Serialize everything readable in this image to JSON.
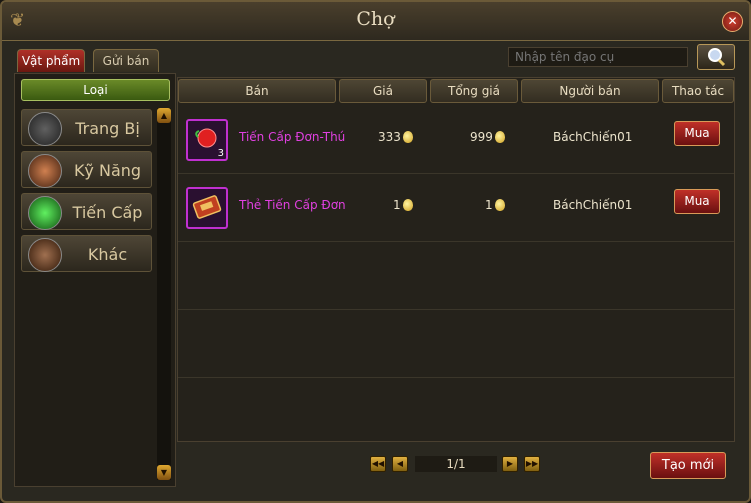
{
  "window": {
    "title": "Chợ",
    "close_label": "✕"
  },
  "tabs": [
    {
      "label": "Vật phẩm",
      "active": true
    },
    {
      "label": "Gửi bán",
      "active": false
    }
  ],
  "search": {
    "placeholder": "Nhập tên đạo cụ"
  },
  "categories": {
    "header": "Loại",
    "items": [
      {
        "label": "Trang Bị",
        "icon": "sword-icon"
      },
      {
        "label": "Kỹ Năng",
        "icon": "skill-book-icon"
      },
      {
        "label": "Tiến Cấp",
        "icon": "green-gem-icon"
      },
      {
        "label": "Khác",
        "icon": "chest-icon"
      }
    ]
  },
  "table": {
    "columns": [
      "Bán",
      "Giá",
      "Tổng giá",
      "Người bán",
      "Thao tác"
    ],
    "rows": [
      {
        "name": "Tiến Cấp Đơn-Thú",
        "qty": "3",
        "price": "333",
        "total": "999",
        "seller": "BáchChiến01",
        "action": "Mua",
        "icon": "red-pill-icon"
      },
      {
        "name": "Thẻ Tiến Cấp Đơn",
        "qty": "",
        "price": "1",
        "total": "1",
        "seller": "BáchChiến01",
        "action": "Mua",
        "icon": "card-icon"
      }
    ]
  },
  "pagination": {
    "text": "1/1"
  },
  "create_button": "Tạo mới",
  "colors": {
    "item_name": "#e040e0",
    "active_tab": "#b03028",
    "category_header": "#5a7a20"
  }
}
